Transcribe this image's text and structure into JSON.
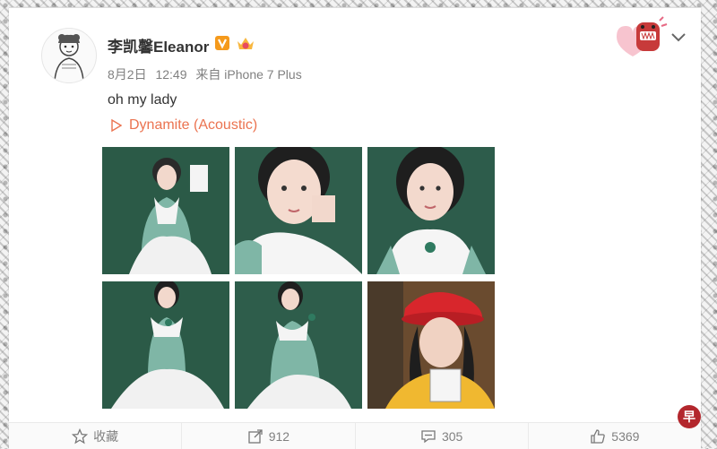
{
  "post": {
    "username": "李凯馨Eleanor",
    "date": "8月2日",
    "time": "12:49",
    "source": "来自 iPhone 7 Plus",
    "text": "oh my lady",
    "music": "Dynamite (Acoustic)"
  },
  "actions": {
    "favorite_label": "收藏",
    "repost_count": "912",
    "comment_count": "305",
    "like_count": "5369"
  },
  "watermark": {
    "text": "早"
  },
  "colors": {
    "accent": "#eb7350",
    "vip": "#f59a1c",
    "bg_green": "#2b5a47",
    "red_cap": "#d8262c"
  },
  "icons": [
    "avatar-sketch-icon",
    "vip-badge-icon",
    "crown-icon",
    "play-icon",
    "chevron-down-icon",
    "sticker-icon",
    "star-icon",
    "share-icon",
    "comment-icon",
    "thumbs-up-icon"
  ]
}
